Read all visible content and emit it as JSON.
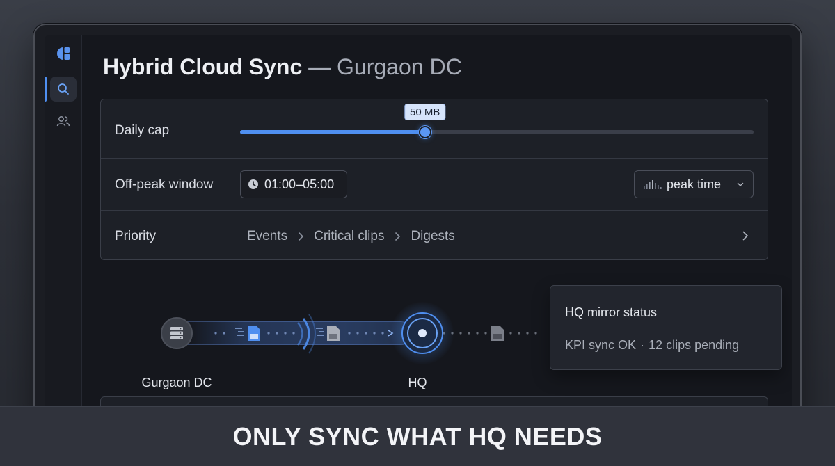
{
  "page": {
    "title": "Hybrid Cloud Sync",
    "title_separator": "—",
    "subtitle": "Gurgaon DC"
  },
  "rail": {
    "items": [
      {
        "icon": "search-icon",
        "active": true
      },
      {
        "icon": "users-icon",
        "active": false
      }
    ]
  },
  "settings": {
    "daily_cap": {
      "label": "Daily cap",
      "value_label": "50 MB",
      "fraction": 0.36
    },
    "off_peak": {
      "label": "Off-peak window",
      "time_range": "01:00–05:00",
      "peak_button_label": "peak time"
    },
    "priority": {
      "label": "Priority",
      "steps": [
        "Events",
        "Critical clips",
        "Digests"
      ]
    }
  },
  "flow": {
    "source_label": "Gurgaon DC",
    "target_label": "HQ"
  },
  "status": {
    "title": "HQ mirror status",
    "kpi": "KPI sync OK",
    "separator": "·",
    "pending": "12 clips pending"
  },
  "banner": {
    "text": "ONLY SYNC WHAT HQ NEEDS"
  },
  "colors": {
    "accent": "#4f8ff0",
    "background": "#15171d",
    "card": "#1d2027"
  }
}
